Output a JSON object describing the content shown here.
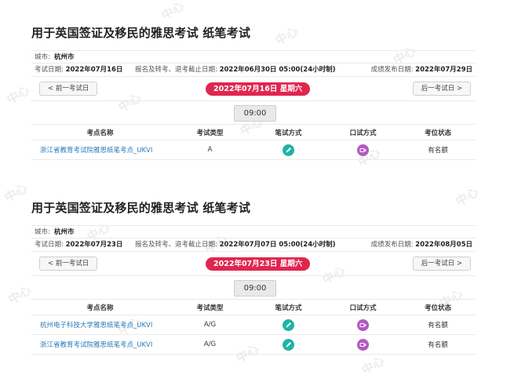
{
  "watermark": "中心",
  "sections": [
    {
      "title": "用于英国签证及移民的雅思考试 纸笔考试",
      "city_label": "城市:",
      "city": "杭州市",
      "exam_date_label": "考试日期:",
      "exam_date": "2022年07月16日",
      "deadline_label": "报名及转考、退考截止日期:",
      "deadline": "2022年06月30日 05:00(24小时制)",
      "result_label": "成绩发布日期:",
      "result_date": "2022年07月29日",
      "prev_label": "< 前一考试日",
      "next_label": "后一考试日 >",
      "current_date": "2022年07月16日 星期六",
      "time": "09:00",
      "headers": [
        "考点名称",
        "考试类型",
        "笔试方式",
        "口试方式",
        "考位状态"
      ],
      "rows": [
        {
          "name": "浙江省教育考试院雅思纸笔考点_UKVI",
          "type": "A",
          "status": "有名额"
        }
      ]
    },
    {
      "title": "用于英国签证及移民的雅思考试 纸笔考试",
      "city_label": "城市:",
      "city": "杭州市",
      "exam_date_label": "考试日期:",
      "exam_date": "2022年07月23日",
      "deadline_label": "报名及转考、退考截止日期:",
      "deadline": "2022年07月07日 05:00(24小时制)",
      "result_label": "成绩发布日期:",
      "result_date": "2022年08月05日",
      "prev_label": "< 前一考试日",
      "next_label": "后一考试日 >",
      "current_date": "2022年07月23日 星期六",
      "time": "09:00",
      "headers": [
        "考点名称",
        "考试类型",
        "笔试方式",
        "口试方式",
        "考位状态"
      ],
      "rows": [
        {
          "name": "杭州电子科技大学雅思纸笔考点_UKVI",
          "type": "A/G",
          "status": "有名额"
        },
        {
          "name": "浙江省教育考试院雅思纸笔考点_UKVI",
          "type": "A/G",
          "status": "有名额"
        }
      ]
    }
  ],
  "colors": {
    "date_pill": "#e0264f",
    "pen_icon": "#1fb3a6",
    "camera_icon": "#b25ac4",
    "link": "#2a7ab8"
  },
  "icons": {
    "written": "pen-icon",
    "oral": "camera-icon"
  }
}
